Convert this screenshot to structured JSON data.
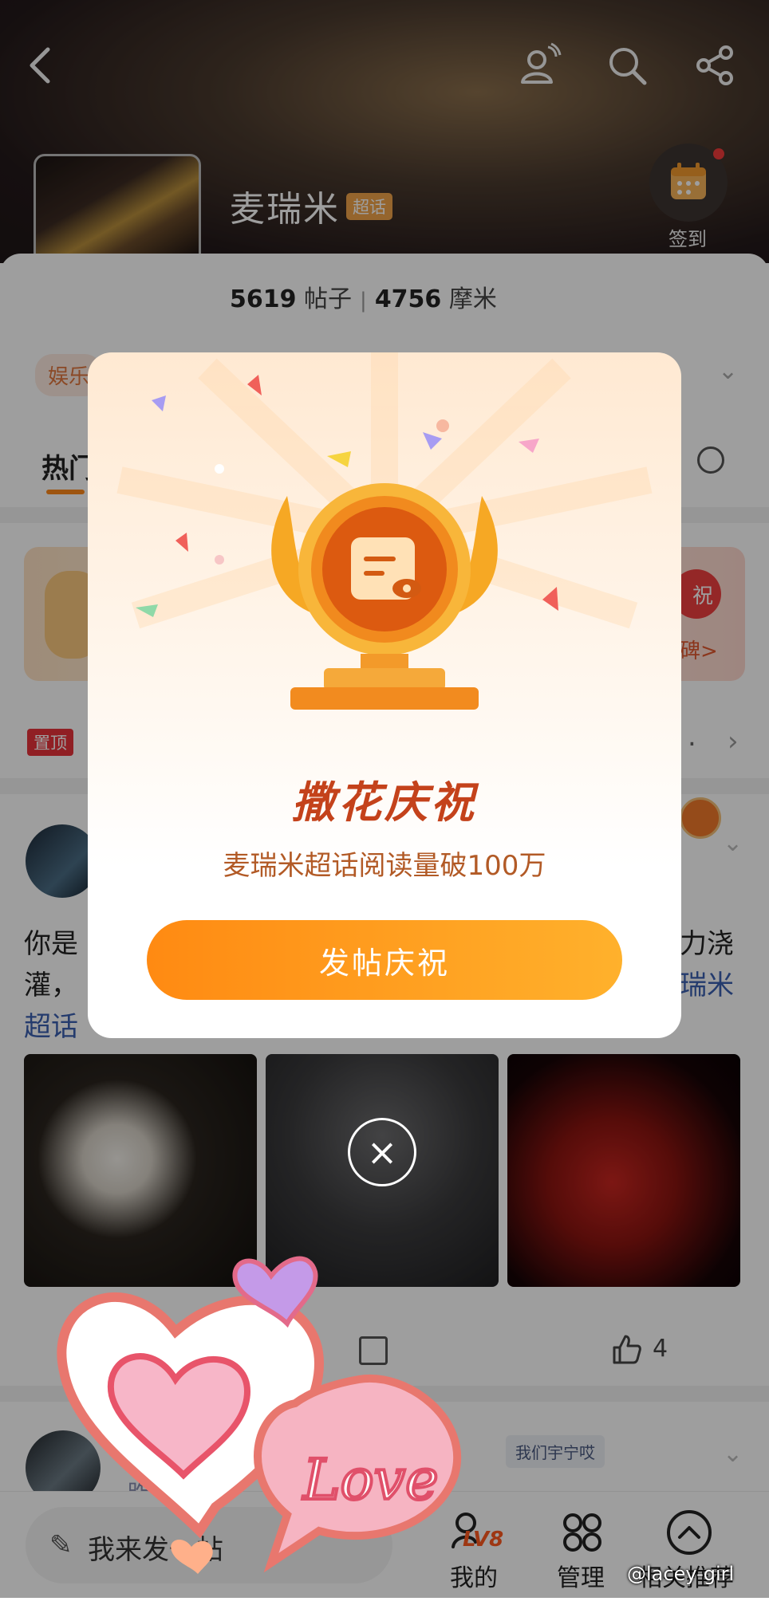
{
  "header": {
    "back_icon": "chevron-left-icon",
    "icons": [
      "user-follow-icon",
      "search-icon",
      "share-icon"
    ],
    "topic_title": "麦瑞米",
    "topic_badge": "超话",
    "checkin_label": "签到"
  },
  "stats": {
    "posts_count": "5619",
    "posts_label": "帖子",
    "members_count": "4756",
    "members_label": "摩米"
  },
  "category_chip": "娱乐",
  "tabs": {
    "hot": "热门"
  },
  "banner": {
    "button_fragment": "祝",
    "link_fragment": "碑>"
  },
  "pinned": {
    "badge": "置顶"
  },
  "post": {
    "text_line1_left": "你是",
    "text_line1_right": "力浇",
    "text_line2_left": "灌，",
    "text_line2_right": "瑞米",
    "text_line3": "超话",
    "like_count": "4"
  },
  "post2": {
    "tag": "我们宇宁哎",
    "meta": "昨天"
  },
  "dialog": {
    "title": "撒花庆祝",
    "subtitle": "麦瑞米超话阅读量破100万",
    "button": "发帖庆祝",
    "close": "×"
  },
  "bottom_nav": {
    "compose_placeholder": "我来发一帖",
    "level": "LV8",
    "items": [
      "我的",
      "管理",
      "相关推荐"
    ]
  },
  "watermark": "@lacey-girl",
  "sticker_text": "Love",
  "colors": {
    "accent": "#ff8a12",
    "title": "#c4421b",
    "link": "#3a5fb0",
    "badge_red": "#e8323a"
  }
}
